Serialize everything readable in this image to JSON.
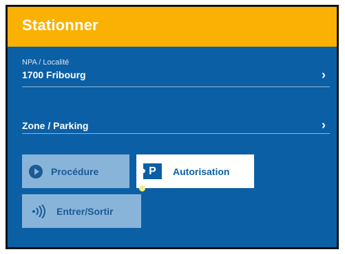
{
  "header": {
    "title": "Stationner"
  },
  "npa": {
    "label": "NPA / Localité",
    "value": "1700 Fribourg",
    "chevron": "›"
  },
  "zone": {
    "value": "Zone / Parking",
    "chevron": "›"
  },
  "buttons": {
    "procedure": {
      "label": "Procédure",
      "icon": "play-circle-icon"
    },
    "autorisation": {
      "label": "Autorisation",
      "icon": "parking-ticket-icon",
      "icon_text": "P"
    },
    "entrer": {
      "label": "Entrer/Sortir",
      "icon": "nfc-icon"
    }
  },
  "colors": {
    "header": "#fbb103",
    "background": "#0b5fa5",
    "button_inactive": "#89b4da",
    "button_active": "#ffffff"
  }
}
